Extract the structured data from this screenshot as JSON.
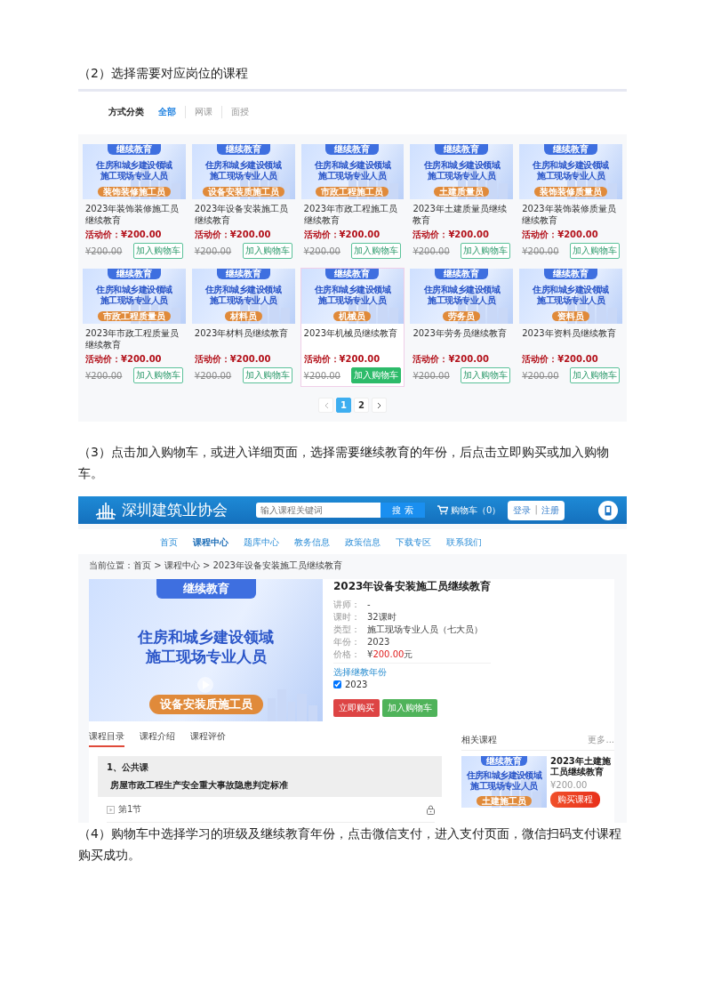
{
  "steps": [
    "（2）选择需要对应岗位的课程",
    "（3）点击加入购物车，或进入详细页面，选择需要继续教育的年份，后点击立即购买或加入购物车。",
    "（4）购物车中选择学习的班级及继续教育年份，点击微信支付，进入支付页面，微信扫码支付课程购买成功。"
  ],
  "list_page": {
    "filter": {
      "label": "方式分类",
      "options": [
        {
          "label": "全部",
          "selected": true
        },
        {
          "label": "网课",
          "selected": false
        },
        {
          "label": "面授",
          "selected": false
        }
      ]
    },
    "courses": [
      {
        "banner": {
          "tag": "继续教育",
          "lines": [
            "住房和城乡建设领域",
            "施工现场专业人员"
          ],
          "role": "装饰装修施工员"
        },
        "title": "2023年装饰装修施工员继续教育",
        "price_label": "活动价：",
        "price": "¥200.00",
        "original_price": "¥200.00",
        "cart_button": "加入购物车",
        "hovered": false
      },
      {
        "banner": {
          "tag": "继续教育",
          "lines": [
            "住房和城乡建设领域",
            "施工现场专业人员"
          ],
          "role": "设备安装质施工员"
        },
        "title": "2023年设备安装施工员继续教育",
        "price_label": "活动价：",
        "price": "¥200.00",
        "original_price": "¥200.00",
        "cart_button": "加入购物车",
        "hovered": false
      },
      {
        "banner": {
          "tag": "继续教育",
          "lines": [
            "住房和城乡建设领域",
            "施工现场专业人员"
          ],
          "role": "市政工程施工员"
        },
        "title": "2023年市政工程施工员继续教育",
        "price_label": "活动价：",
        "price": "¥200.00",
        "original_price": "¥200.00",
        "cart_button": "加入购物车",
        "hovered": false
      },
      {
        "banner": {
          "tag": "继续教育",
          "lines": [
            "住房和城乡建设领域",
            "施工现场专业人员"
          ],
          "role": "土建质量员"
        },
        "title": "2023年土建质量员继续教育",
        "price_label": "活动价：",
        "price": "¥200.00",
        "original_price": "¥200.00",
        "cart_button": "加入购物车",
        "hovered": false
      },
      {
        "banner": {
          "tag": "继续教育",
          "lines": [
            "住房和城乡建设领域",
            "施工现场专业人员"
          ],
          "role": "装饰装修质量员"
        },
        "title": "2023年装饰装修质量员继续教育",
        "price_label": "活动价：",
        "price": "¥200.00",
        "original_price": "¥200.00",
        "cart_button": "加入购物车",
        "hovered": false
      },
      {
        "banner": {
          "tag": "继续教育",
          "lines": [
            "住房和城乡建设领域",
            "施工现场专业人员"
          ],
          "role": "市政工程质量员"
        },
        "title": "2023年市政工程质量员继续教育",
        "price_label": "活动价：",
        "price": "¥200.00",
        "original_price": "¥200.00",
        "cart_button": "加入购物车",
        "hovered": false
      },
      {
        "banner": {
          "tag": "继续教育",
          "lines": [
            "住房和城乡建设领域",
            "施工现场专业人员"
          ],
          "role": "材料员"
        },
        "title": "2023年材料员继续教育",
        "price_label": "活动价：",
        "price": "¥200.00",
        "original_price": "¥200.00",
        "cart_button": "加入购物车",
        "hovered": false
      },
      {
        "banner": {
          "tag": "继续教育",
          "lines": [
            "住房和城乡建设领域",
            "施工现场专业人员"
          ],
          "role": "机械员"
        },
        "title": "2023年机械员继续教育",
        "price_label": "活动价：",
        "price": "¥200.00",
        "original_price": "¥200.00",
        "cart_button": "加入购物车",
        "hovered": true
      },
      {
        "banner": {
          "tag": "继续教育",
          "lines": [
            "住房和城乡建设领域",
            "施工现场专业人员"
          ],
          "role": "劳务员"
        },
        "title": "2023年劳务员继续教育",
        "price_label": "活动价：",
        "price": "¥200.00",
        "original_price": "¥200.00",
        "cart_button": "加入购物车",
        "hovered": false
      },
      {
        "banner": {
          "tag": "继续教育",
          "lines": [
            "住房和城乡建设领域",
            "施工现场专业人员"
          ],
          "role": "资料员"
        },
        "title": "2023年资料员继续教育",
        "price_label": "活动价：",
        "price": "¥200.00",
        "original_price": "¥200.00",
        "cart_button": "加入购物车",
        "hovered": false
      }
    ],
    "pagination": [
      {
        "label": "1",
        "selected": true
      },
      {
        "label": "2",
        "selected": false
      }
    ]
  },
  "detail_page": {
    "header": {
      "site_name": "深圳建筑业协会",
      "search_placeholder": "输入课程关键词",
      "search_button": "搜 索",
      "cart": "购物车（0）",
      "login": "登录",
      "separator": "|",
      "register": "注册"
    },
    "nav": [
      {
        "label": "首页",
        "selected": false
      },
      {
        "label": "课程中心",
        "selected": true
      },
      {
        "label": "题库中心",
        "selected": false
      },
      {
        "label": "教务信息",
        "selected": false
      },
      {
        "label": "政策信息",
        "selected": false
      },
      {
        "label": "下载专区",
        "selected": false
      },
      {
        "label": "联系我们",
        "selected": false
      }
    ],
    "breadcrumb": "当前位置：首页 > 课程中心 > 2023年设备安装施工员继续教育",
    "banner": {
      "tag": "继续教育",
      "lines": [
        "住房和城乡建设领域",
        "施工现场专业人员"
      ],
      "role": "设备安装质施工员"
    },
    "title": "2023年设备安装施工员继续教育",
    "info": [
      {
        "label": "讲师：",
        "value": "-"
      },
      {
        "label": "课时：",
        "value": "32课时"
      },
      {
        "label": "类型：",
        "value": "施工现场专业人员（七大员）"
      },
      {
        "label": "年份：",
        "value": "2023"
      }
    ],
    "price": {
      "label": "价格：",
      "currency": "¥",
      "amount": "200.00",
      "unit": "元"
    },
    "year_select": {
      "label": "选择继教年份",
      "options": [
        {
          "label": "2023",
          "checked": true
        }
      ]
    },
    "buy_button": "立即购买",
    "cart_button": "加入购物车",
    "tabs": [
      {
        "label": "课程目录",
        "selected": true
      },
      {
        "label": "课程介绍",
        "selected": false
      },
      {
        "label": "课程评价",
        "selected": false
      }
    ],
    "chapter": {
      "title": "1、公共课",
      "lesson": "房屋市政工程生产安全重大事故隐患判定标准",
      "sections": [
        {
          "label": "第1节",
          "locked": true
        }
      ]
    },
    "related": {
      "title": "相关课程",
      "more": "更多...",
      "items": [
        {
          "banner": {
            "tag": "继续教育",
            "lines": [
              "住房和城乡建设领域",
              "施工现场专业人员"
            ],
            "role": "土建施工员"
          },
          "title": "2023年土建施工员继续教育",
          "price": "¥200.00",
          "button": "购买课程"
        }
      ]
    }
  }
}
